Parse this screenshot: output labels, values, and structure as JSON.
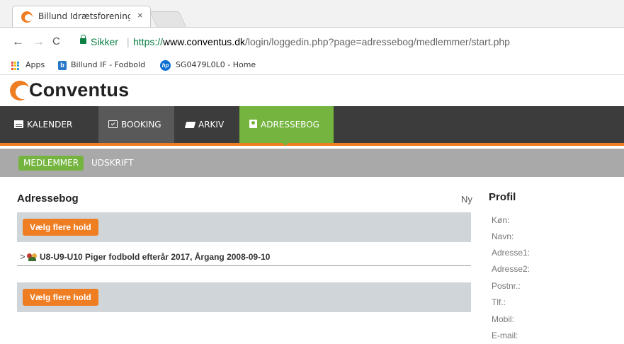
{
  "browser": {
    "tab_title": "Billund Idrætsforening (B",
    "tab_title_fade": "B",
    "tab_close": "×",
    "back": "←",
    "forward": "→",
    "reload": "C",
    "secure_label": "Sikker",
    "separator": "|",
    "url_scheme": "https://",
    "url_host": "www.conventus.dk",
    "url_path": "/login/loggedin.php?page=adressebog/medlemmer/start.php",
    "bookmarks": {
      "apps": "Apps",
      "item1": "Billund IF - Fodbold",
      "item2": "SG0479L0L0 - Home"
    }
  },
  "site": {
    "logo_text": "Conventus",
    "colors": {
      "orange": "#ef7d22",
      "green": "#74b43f",
      "dark": "#3c3c3c"
    },
    "nav": [
      {
        "label": "KALENDER",
        "icon": "calendar-icon"
      },
      {
        "label": "BOOKING",
        "icon": "calendar-check-icon"
      },
      {
        "label": "ARKIV",
        "icon": "folder-icon"
      },
      {
        "label": "ADRESSEBOG",
        "icon": "address-book-icon"
      }
    ],
    "subnav": [
      "MEDLEMMER",
      "UDSKRIFT"
    ]
  },
  "main": {
    "title": "Adressebog",
    "new_link": "Ny",
    "select_teams_button": "Vælg flere hold",
    "group_chevron": ">",
    "group_label": "U8-U9-U10 Piger fodbold efterår 2017, Årgang 2008-09-10"
  },
  "profile": {
    "title": "Profil",
    "fields": [
      "Køn:",
      "Navn:",
      "Adresse1:",
      "Adresse2:",
      "Postnr.:",
      "Tlf.:",
      "Mobil:",
      "E-mail:"
    ]
  }
}
